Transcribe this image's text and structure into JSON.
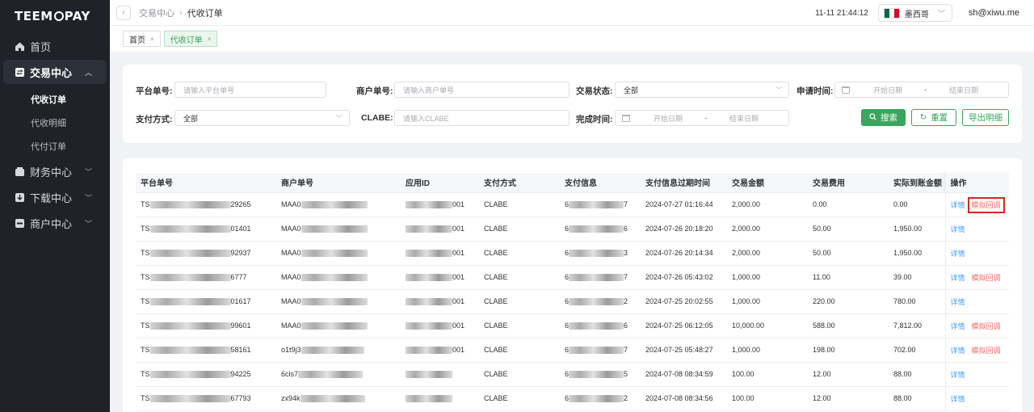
{
  "brand": {
    "logo_pre": "TEEM",
    "logo_post": "PAY"
  },
  "sidebar": {
    "items": [
      {
        "label": "首页",
        "icon": "home-icon"
      },
      {
        "label": "交易中心",
        "icon": "exchange-icon",
        "sub": [
          "代收订单",
          "代收明细",
          "代付订单"
        ]
      },
      {
        "label": "财务中心",
        "icon": "wallet-icon"
      },
      {
        "label": "下载中心",
        "icon": "download-icon"
      },
      {
        "label": "商户中心",
        "icon": "merchant-icon"
      }
    ]
  },
  "topbar": {
    "breadcrumb": [
      "交易中心",
      "代收订单"
    ],
    "clock": "11-11 21:44:12",
    "country": "墨西哥",
    "user": "sh@xiwu.me"
  },
  "tabs": [
    "首页",
    "代收订单"
  ],
  "filters": {
    "platform_no": {
      "label": "平台单号:",
      "placeholder": "请输入平台单号"
    },
    "merchant_no": {
      "label": "商户单号:",
      "placeholder": "请输入商户单号"
    },
    "status": {
      "label": "交易状态:",
      "value": "全部"
    },
    "apply_time": {
      "label": "申请时间:",
      "start": "开始日期",
      "end": "结束日期",
      "sep": "-"
    },
    "pay_method": {
      "label": "支付方式:",
      "value": "全部"
    },
    "clabe": {
      "label": "CLABE:",
      "placeholder": "请输入CLABE"
    },
    "finish_time": {
      "label": "完成时间:",
      "start": "开始日期",
      "end": "结束日期",
      "sep": "-"
    },
    "search_btn": "搜索",
    "reset_btn": "重置",
    "export_btn": "导出明细"
  },
  "table": {
    "columns": [
      "平台单号",
      "商户单号",
      "应用ID",
      "支付方式",
      "支付信息",
      "支付信息过期时间",
      "交易金额",
      "交易费用",
      "实际到账金额",
      "操作"
    ],
    "detail_label": "详情",
    "callback_label": "模拟回调",
    "rows": [
      {
        "platform_pre": "TS",
        "platform_suf": "29265",
        "merchant_pre": "MAA0",
        "app_suf": "001",
        "method": "CLABE",
        "pay_pre": "6",
        "pay_suf": "7",
        "expire": "2024-07-27 01:16:44",
        "amount": "2,000.00",
        "fee": "0.00",
        "actual": "0.00",
        "callback": true
      },
      {
        "platform_pre": "TS",
        "platform_suf": "01401",
        "merchant_pre": "MAA0",
        "app_suf": "001",
        "method": "CLABE",
        "pay_pre": "6",
        "pay_suf": "6",
        "expire": "2024-07-26 20:18:20",
        "amount": "2,000.00",
        "fee": "50.00",
        "actual": "1,950.00",
        "callback": false
      },
      {
        "platform_pre": "TS",
        "platform_suf": "92937",
        "merchant_pre": "MAA0",
        "app_suf": "001",
        "method": "CLABE",
        "pay_pre": "6",
        "pay_suf": "3",
        "expire": "2024-07-26 20:14:34",
        "amount": "2,000.00",
        "fee": "50.00",
        "actual": "1,950.00",
        "callback": false
      },
      {
        "platform_pre": "TS",
        "platform_suf": "6777",
        "merchant_pre": "MAA0",
        "app_suf": "001",
        "method": "CLABE",
        "pay_pre": "6",
        "pay_suf": "7",
        "expire": "2024-07-26 05:43:02",
        "amount": "1,000.00",
        "fee": "11.00",
        "actual": "39.00",
        "callback": true
      },
      {
        "platform_pre": "TS",
        "platform_suf": "01617",
        "merchant_pre": "MAA0",
        "app_suf": "001",
        "method": "CLABE",
        "pay_pre": "6",
        "pay_suf": "2",
        "expire": "2024-07-25 20:02:55",
        "amount": "1,000.00",
        "fee": "220.00",
        "actual": "780.00",
        "callback": false
      },
      {
        "platform_pre": "TS",
        "platform_suf": "99601",
        "merchant_pre": "MAA0",
        "app_suf": "001",
        "method": "CLABE",
        "pay_pre": "6",
        "pay_suf": "6",
        "expire": "2024-07-25 06:12:05",
        "amount": "10,000.00",
        "fee": "588.00",
        "actual": "7,812.00",
        "callback": true
      },
      {
        "platform_pre": "TS",
        "platform_suf": "58161",
        "merchant_pre": "o1t9j3",
        "app_suf": "001",
        "method": "CLABE",
        "pay_pre": "6",
        "pay_suf": "7",
        "expire": "2024-07-25 05:48:27",
        "amount": "1,000.00",
        "fee": "198.00",
        "actual": "702.00",
        "callback": true
      },
      {
        "platform_pre": "TS",
        "platform_suf": "94225",
        "merchant_pre": "6cis7",
        "app_suf": "",
        "method": "CLABE",
        "pay_pre": "6",
        "pay_suf": "5",
        "expire": "2024-07-08 08:34:59",
        "amount": "100.00",
        "fee": "12.00",
        "actual": "88.00",
        "callback": false
      },
      {
        "platform_pre": "TS",
        "platform_suf": "67793",
        "merchant_pre": "zx94k",
        "app_suf": "",
        "method": "CLABE",
        "pay_pre": "6",
        "pay_suf": "2",
        "expire": "2024-07-08 08:34:56",
        "amount": "100.00",
        "fee": "12.00",
        "actual": "88.00",
        "callback": false
      }
    ]
  },
  "colors": {
    "accent": "#3aa55c",
    "link": "#409eff",
    "warn": "#f56c6c",
    "highlight": "#d9261c"
  }
}
